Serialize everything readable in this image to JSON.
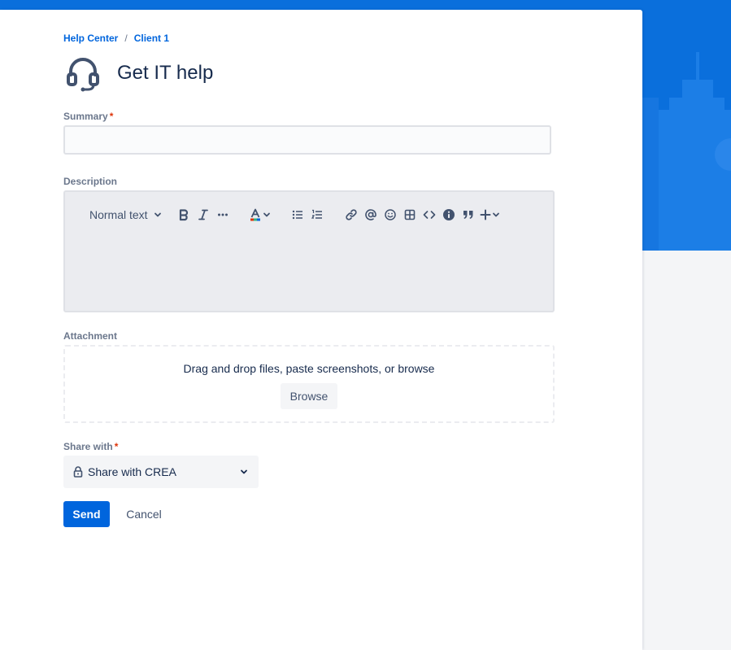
{
  "breadcrumb": {
    "items": [
      "Help Center",
      "Client 1"
    ],
    "separator": "/"
  },
  "header": {
    "title": "Get IT help",
    "icon": "headset-icon"
  },
  "form": {
    "summary": {
      "label": "Summary",
      "required_mark": "*",
      "value": "",
      "placeholder": ""
    },
    "description": {
      "label": "Description",
      "toolbar": {
        "text_style": "Normal text",
        "buttons": [
          "bold",
          "italic",
          "more-formatting",
          "text-color",
          "bullet-list",
          "numbered-list",
          "link",
          "mention",
          "emoji",
          "table",
          "code-block",
          "info-panel",
          "quote",
          "insert-more"
        ]
      }
    },
    "attachment": {
      "label": "Attachment",
      "drop_text": "Drag and drop files, paste screenshots, or browse",
      "browse_label": "Browse"
    },
    "share_with": {
      "label": "Share with",
      "required_mark": "*",
      "value": "Share with CREA"
    },
    "actions": {
      "send_label": "Send",
      "cancel_label": "Cancel"
    }
  },
  "colors": {
    "primary": "#0065dd",
    "banner": "#0a6fdc",
    "text": "#172b4d",
    "muted": "#6b778c",
    "required": "#de350b"
  }
}
